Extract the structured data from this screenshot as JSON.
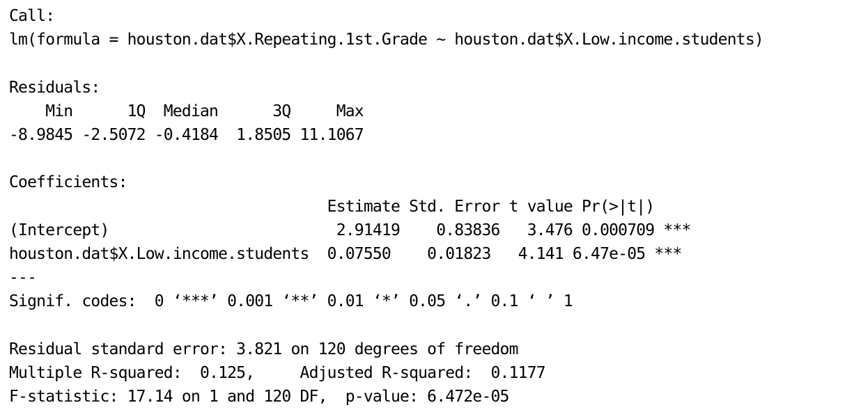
{
  "console": {
    "lines": [
      "Call:",
      "lm(formula = houston.dat$X.Repeating.1st.Grade ~ houston.dat$X.Low.income.students)",
      "",
      "Residuals:",
      "    Min      1Q  Median      3Q     Max ",
      "-8.9845 -2.5072 -0.4184  1.8505 11.1067 ",
      "",
      "Coefficients:",
      "                                   Estimate Std. Error t value Pr(>|t|)    ",
      "(Intercept)                         2.91419    0.83836   3.476 0.000709 ***",
      "houston.dat$X.Low.income.students  0.07550    0.01823   4.141 6.47e-05 ***",
      "---",
      "Signif. codes:  0 ‘***’ 0.001 ‘**’ 0.01 ‘*’ 0.05 ‘.’ 0.1 ‘ ’ 1",
      "",
      "Residual standard error: 3.821 on 120 degrees of freedom",
      "Multiple R-squared:  0.125,\tAdjusted R-squared:  0.1177 ",
      "F-statistic: 17.14 on 1 and 120 DF,  p-value: 6.472e-05"
    ]
  }
}
